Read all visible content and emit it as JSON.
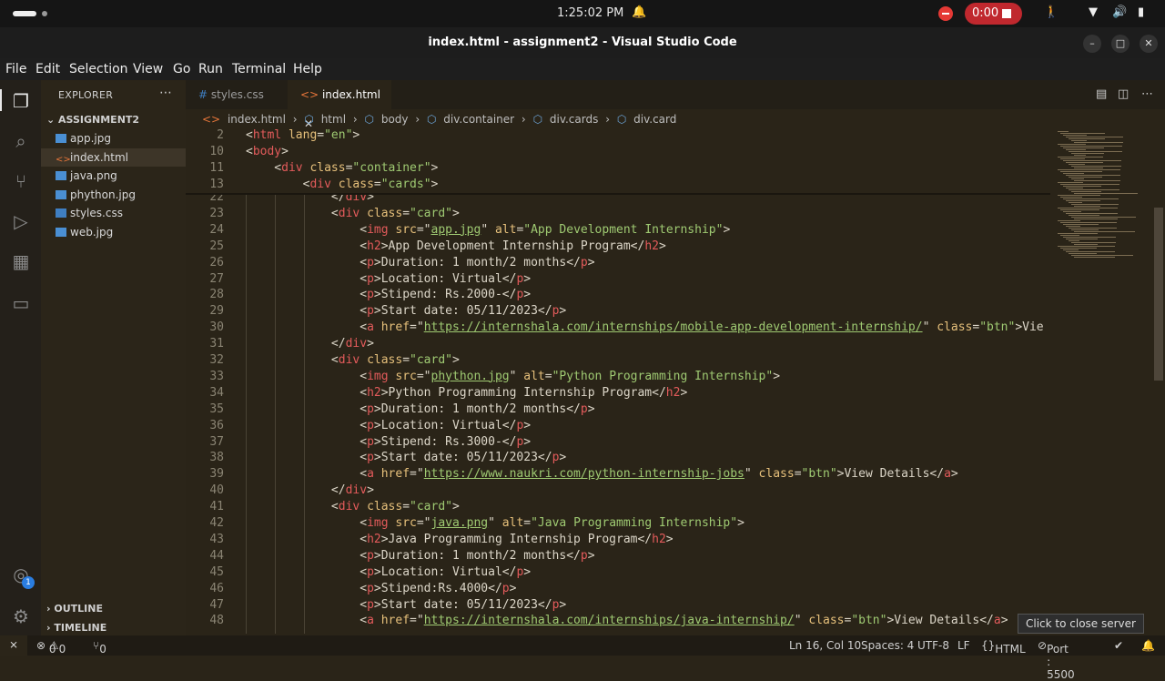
{
  "system": {
    "time": "1:25:02 PM",
    "recording": "0:00"
  },
  "window": {
    "title": "index.html - assignment2 - Visual Studio Code"
  },
  "menu": [
    "File",
    "Edit",
    "Selection",
    "View",
    "Go",
    "Run",
    "Terminal",
    "Help"
  ],
  "sidebar": {
    "title": "EXPLORER",
    "folder": "ASSIGNMENT2",
    "files": [
      "app.jpg",
      "index.html",
      "java.png",
      "phython.jpg",
      "styles.css",
      "web.jpg"
    ],
    "outline": "OUTLINE",
    "timeline": "TIMELINE"
  },
  "tabs": [
    "styles.css",
    "index.html"
  ],
  "breadcrumbs": [
    "index.html",
    "html",
    "body",
    "div.container",
    "div.cards",
    "div.card"
  ],
  "sticky_lines": [
    {
      "n": "2",
      "code": "<html lang=\"en\">"
    },
    {
      "n": "10",
      "code": "<body>"
    },
    {
      "n": "11",
      "code": "    <div class=\"container\">"
    },
    {
      "n": "13",
      "code": "        <div class=\"cards\">"
    }
  ],
  "code_lines": [
    {
      "n": "22",
      "code": "            </div>"
    },
    {
      "n": "23",
      "code": "            <div class=\"card\">"
    },
    {
      "n": "24",
      "code": "                <img src=\"app.jpg\" alt=\"App Development Internship\">"
    },
    {
      "n": "25",
      "code": "                <h2>App Development Internship Program</h2>"
    },
    {
      "n": "26",
      "code": "                <p>Duration: 1 month/2 months</p>"
    },
    {
      "n": "27",
      "code": "                <p>Location: Virtual</p>"
    },
    {
      "n": "28",
      "code": "                <p>Stipend: Rs.2000-</p>"
    },
    {
      "n": "29",
      "code": "                <p>Start date: 05/11/2023</p>"
    },
    {
      "n": "30",
      "code": "                <a href=\"https://internshala.com/internships/mobile-app-development-internship/\" class=\"btn\">Vie"
    },
    {
      "n": "31",
      "code": "            </div>"
    },
    {
      "n": "32",
      "code": "            <div class=\"card\">"
    },
    {
      "n": "33",
      "code": "                <img src=\"phython.jpg\" alt=\"Python Programming Internship\">"
    },
    {
      "n": "34",
      "code": "                <h2>Python Programming Internship Program</h2>"
    },
    {
      "n": "35",
      "code": "                <p>Duration: 1 month/2 months</p>"
    },
    {
      "n": "36",
      "code": "                <p>Location: Virtual</p>"
    },
    {
      "n": "37",
      "code": "                <p>Stipend: Rs.3000-</p>"
    },
    {
      "n": "38",
      "code": "                <p>Start date: 05/11/2023</p>"
    },
    {
      "n": "39",
      "code": "                <a href=\"https://www.naukri.com/python-internship-jobs\" class=\"btn\">View Details</a>"
    },
    {
      "n": "40",
      "code": "            </div>"
    },
    {
      "n": "41",
      "code": "            <div class=\"card\">"
    },
    {
      "n": "42",
      "code": "                <img src=\"java.png\" alt=\"Java Programming Internship\">"
    },
    {
      "n": "43",
      "code": "                <h2>Java Programming Internship Program</h2>"
    },
    {
      "n": "44",
      "code": "                <p>Duration: 1 month/2 months</p>"
    },
    {
      "n": "45",
      "code": "                <p>Location: Virtual</p>"
    },
    {
      "n": "46",
      "code": "                <p>Stipend:Rs.4000</p>"
    },
    {
      "n": "47",
      "code": "                <p>Start date: 05/11/2023</p>"
    },
    {
      "n": "48",
      "code": "                <a href=\"https://internshala.com/internships/java-internship/\" class=\"btn\">View Details</a>"
    }
  ],
  "status": {
    "errors": "0",
    "warnings": "0",
    "ports": "0",
    "position": "Ln 16, Col 10",
    "spaces": "Spaces: 4",
    "encoding": "UTF-8",
    "eol": "LF",
    "language": "HTML",
    "port": "Port : 5500"
  },
  "tooltip": "Click to close server",
  "colors": {
    "tag": "#e35b5b",
    "attr": "#e6c07b",
    "string": "#9fca72",
    "record": "#c0282e"
  }
}
